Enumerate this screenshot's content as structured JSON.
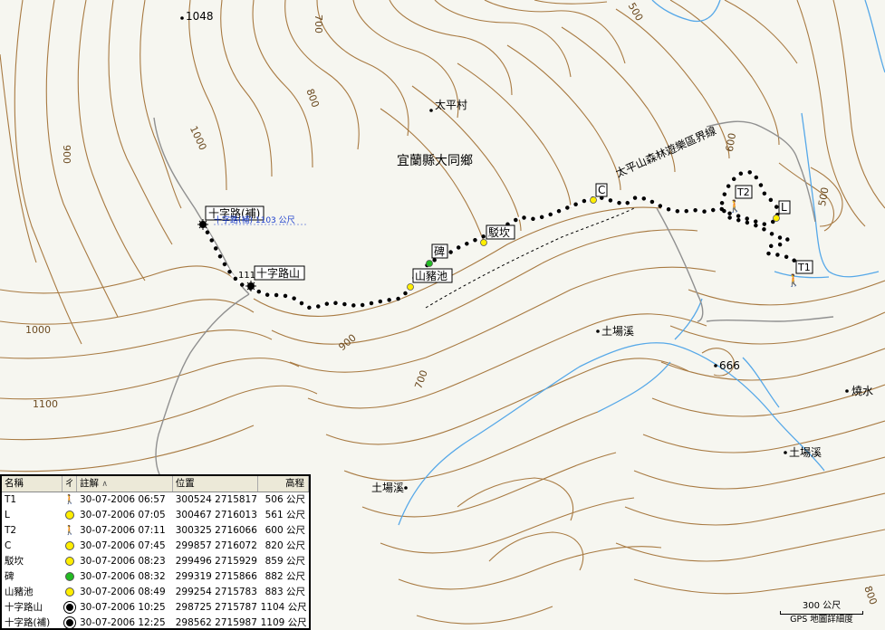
{
  "map": {
    "place_labels": {
      "county": "宜蘭縣大同鄉",
      "village": "太平村",
      "boundary": "太平山森林遊樂區界線",
      "creek1": "土場溪",
      "creek2": "土場溪",
      "creek3": "土場溪",
      "shaoshui": "燒水"
    },
    "contour_labels": [
      "1048",
      "700",
      "800",
      "900",
      "1000",
      "1000",
      "1100",
      "900",
      "700",
      "600",
      "500",
      "500",
      "666",
      "800"
    ],
    "waypoint_labels": {
      "cross_fill": "十字路(補)",
      "cross_fill_elev": "十字路(補) 1103 公尺",
      "cross_mtn": "十字路山",
      "cross_mtn_elev": "111",
      "pig_pond": "山豬池",
      "stele": "碑",
      "jukan": "駁坎",
      "c": "C",
      "t2": "T2",
      "l": "L",
      "t1": "T1"
    },
    "scale": {
      "label": "300 公尺",
      "footer": "GPS 地圖詳細度"
    }
  },
  "waypoint_table": {
    "columns": [
      "名稱",
      "ㄔ",
      "註解",
      "位置",
      "高程"
    ],
    "sort_marker": "∧",
    "rows": [
      {
        "name": "T1",
        "icon": "hiker",
        "note": "30-07-2006 06:57",
        "pos": "300524 2715817",
        "elev": "506 公尺"
      },
      {
        "name": "L",
        "icon": "yellow",
        "note": "30-07-2006 07:05",
        "pos": "300467 2716013",
        "elev": "561 公尺"
      },
      {
        "name": "T2",
        "icon": "hiker",
        "note": "30-07-2006 07:11",
        "pos": "300325 2716066",
        "elev": "600 公尺"
      },
      {
        "name": "C",
        "icon": "yellow",
        "note": "30-07-2006 07:45",
        "pos": "299857 2716072",
        "elev": "820 公尺"
      },
      {
        "name": "駁坎",
        "icon": "yellow",
        "note": "30-07-2006 08:23",
        "pos": "299496 2715929",
        "elev": "859 公尺"
      },
      {
        "name": "碑",
        "icon": "green",
        "note": "30-07-2006 08:32",
        "pos": "299319 2715866",
        "elev": "882 公尺"
      },
      {
        "name": "山豬池",
        "icon": "yellow",
        "note": "30-07-2006 08:49",
        "pos": "299254 2715783",
        "elev": "883 公尺"
      },
      {
        "name": "十字路山",
        "icon": "summit",
        "note": "30-07-2006 10:25",
        "pos": "298725 2715787",
        "elev": "1104 公尺"
      },
      {
        "name": "十字路(補)",
        "icon": "summit",
        "note": "30-07-2006 12:25",
        "pos": "298562 2715987",
        "elev": "1109 公尺"
      }
    ]
  },
  "colors": {
    "contour": "#a87a42",
    "river": "#56a8e8",
    "road": "#909090",
    "paper": "#f6f6f0"
  }
}
